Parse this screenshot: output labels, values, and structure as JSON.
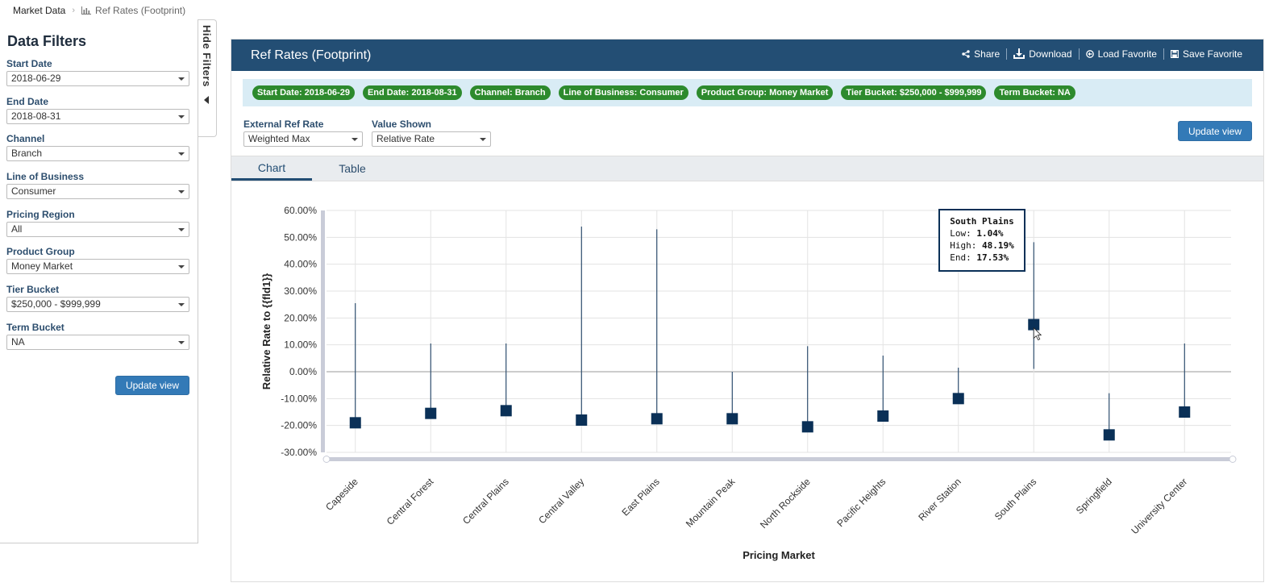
{
  "breadcrumb": {
    "root": "Market Data",
    "current": "Ref Rates (Footprint)"
  },
  "filters": {
    "title": "Data Filters",
    "fields": [
      {
        "label": "Start Date",
        "value": "2018-06-29"
      },
      {
        "label": "End Date",
        "value": "2018-08-31"
      },
      {
        "label": "Channel",
        "value": "Branch"
      },
      {
        "label": "Line of Business",
        "value": "Consumer"
      },
      {
        "label": "Pricing Region",
        "value": "All"
      },
      {
        "label": "Product Group",
        "value": "Money Market"
      },
      {
        "label": "Tier Bucket",
        "value": "$250,000 - $999,999"
      },
      {
        "label": "Term Bucket",
        "value": "NA"
      }
    ],
    "update_label": "Update view",
    "hide_label": "Hide Filters"
  },
  "main": {
    "title": "Ref Rates (Footprint)",
    "actions": {
      "share": "Share",
      "download": "Download",
      "load": "Load Favorite",
      "save": "Save Favorite"
    },
    "pills": [
      "Start Date: 2018-06-29",
      "End Date: 2018-08-31",
      "Channel: Branch",
      "Line of Business: Consumer",
      "Product Group: Money Market",
      "Tier Bucket: $250,000 - $999,999",
      "Term Bucket: NA"
    ],
    "controls": {
      "ref_rate_label": "External Ref Rate",
      "ref_rate_value": "Weighted Max",
      "value_shown_label": "Value Shown",
      "value_shown_value": "Relative Rate"
    },
    "update_label": "Update view",
    "tabs": {
      "chart": "Chart",
      "table": "Table"
    }
  },
  "colors": {
    "header": "#234e74",
    "pill": "#2d8a2d",
    "pill_bar": "#d9ecf5",
    "marker": "#0a3057",
    "button": "#337ab7"
  },
  "tooltip": {
    "title": "South Plains",
    "low_label": "Low:",
    "low": "1.04%",
    "high_label": "High:",
    "high": "48.19%",
    "end_label": "End:",
    "end": "17.53%"
  },
  "chart_data": {
    "type": "scatter",
    "ylabel": "Relative Rate to {{fld1}}",
    "xlabel": "Pricing Market",
    "ylim": [
      -30,
      60
    ],
    "yticks": [
      60,
      50,
      40,
      30,
      20,
      10,
      0,
      -10,
      -20,
      -30
    ],
    "ytick_labels": [
      "60.00%",
      "50.00%",
      "40.00%",
      "30.00%",
      "20.00%",
      "10.00%",
      "0.00%",
      "-10.00%",
      "-20.00%",
      "-30.00%"
    ],
    "grid": true,
    "categories": [
      "Capeside",
      "Central Forest",
      "Central Plains",
      "Central Valley",
      "East Plains",
      "Mountain Peak",
      "North Rockside",
      "Pacific Heights",
      "River Station",
      "South Plains",
      "Springfield",
      "University Center"
    ],
    "low": [
      -20.5,
      -16.5,
      -15.5,
      -19,
      -18,
      -18.5,
      -21,
      -17.5,
      -11,
      1.04,
      -24,
      -15.5
    ],
    "high": [
      25.5,
      10.5,
      10.5,
      54,
      53,
      0,
      9.5,
      6,
      1.5,
      48.19,
      -8,
      10.5
    ],
    "end": [
      -19,
      -15.5,
      -14.5,
      -18,
      -17.5,
      -17.5,
      -20.5,
      -16.5,
      -10,
      17.53,
      -23.5,
      -15
    ]
  }
}
